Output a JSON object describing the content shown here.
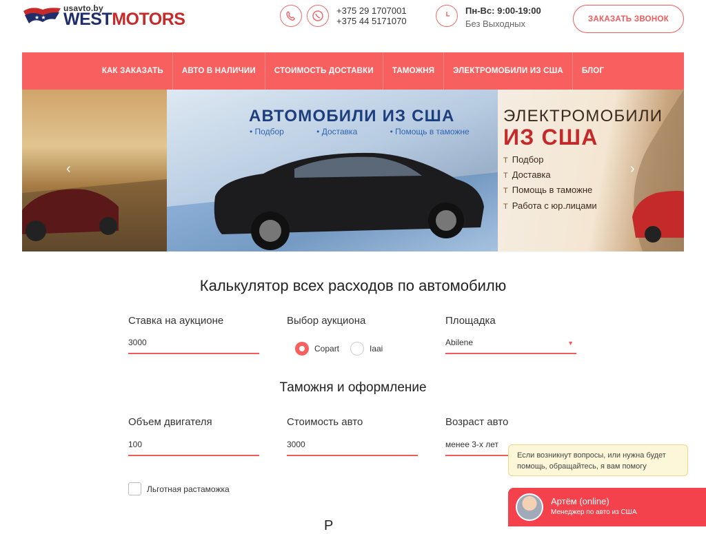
{
  "header": {
    "logo_small": "usavto.by",
    "logo_west": "WEST",
    "logo_motors": "MOTORS",
    "phone1": "+375 29 1707001",
    "phone2": "+375 44 5171070",
    "hours_title": "Пн-Вс: 9:00-19:00",
    "hours_sub": "Без Выходных",
    "callback_label": "ЗАКАЗАТЬ ЗВОНОК",
    "viber_icon": "viber-icon",
    "whatsapp_icon": "whatsapp-icon",
    "clock_icon": "clock-icon"
  },
  "nav": {
    "items": [
      "КАК ЗАКАЗАТЬ",
      "АВТО В НАЛИЧИИ",
      "СТОИМОСТЬ ДОСТАВКИ",
      "ТАМОЖНЯ",
      "ЭЛЕКТРОМОБИЛИ ИЗ США",
      "БЛОГ"
    ]
  },
  "banner": {
    "mid_title": "АВТОМОБИЛИ ИЗ США",
    "mid_points": [
      "Подбор",
      "Доставка",
      "Помощь в таможне"
    ],
    "right_title1": "ЭЛЕКТРОМОБИЛИ",
    "right_title2": "ИЗ США",
    "right_points": [
      "Подбор",
      "Доставка",
      "Помощь в таможне",
      "Работа с юр.лицами"
    ]
  },
  "calculator": {
    "title": "Калькулятор всех расходов по автомобилю",
    "bid_label": "Ставка на аукционе",
    "bid_value": "3000",
    "auction_label": "Выбор аукциона",
    "auction_options": [
      "Copart",
      "Iaai"
    ],
    "auction_selected": "Copart",
    "site_label": "Площадка",
    "site_value": "Abilene"
  },
  "customs": {
    "title": "Таможня и оформление",
    "engine_label": "Объем двигателя",
    "engine_value": "100",
    "price_label": "Стоимость авто",
    "price_value": "3000",
    "age_label": "Возраст авто",
    "age_value": "менее 3-х лет",
    "preferential_label": "Льготная растаможка"
  },
  "next_section_title": "Р",
  "chat": {
    "bubble": "Если возникнут вопросы, или нужна будет помощь, обращайтесь, я вам помогу",
    "name": "Артём (online)",
    "role": "Менеджер по авто из США"
  },
  "colors": {
    "accent": "#f85f5f",
    "brand_red": "#c72a2a",
    "brand_blue": "#1f2e6b"
  }
}
